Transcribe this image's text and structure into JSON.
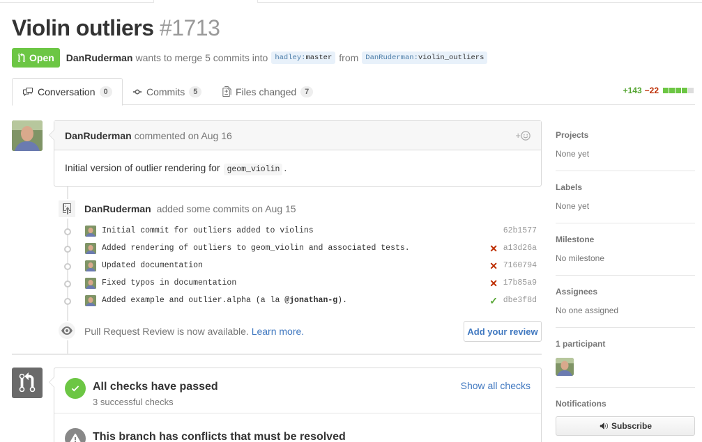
{
  "pr": {
    "title": "Violin outliers",
    "number": "#1713",
    "state": "Open",
    "author": "DanRuderman",
    "merge_text": "wants to merge 5 commits into",
    "base_user": "hadley",
    "base_branch": "master",
    "from_text": "from",
    "head_user": "DanRuderman",
    "head_branch": "violin_outliers"
  },
  "tabs": [
    {
      "label": "Conversation",
      "count": "0",
      "icon": "comment-discussion-icon"
    },
    {
      "label": "Commits",
      "count": "5",
      "icon": "git-commit-icon"
    },
    {
      "label": "Files changed",
      "count": "7",
      "icon": "diff-icon"
    }
  ],
  "diffstat": {
    "additions": "+143",
    "deletions": "−22",
    "add_color": "#55a532",
    "del_color": "#bd2c00",
    "neutral_color": "#ddd"
  },
  "comment": {
    "author": "DanRuderman",
    "action": "commented on Aug 16",
    "body_prefix": "Initial version of outlier rendering for",
    "body_code": "geom_violin",
    "body_suffix": "."
  },
  "commits_event": {
    "author": "DanRuderman",
    "action": "added some commits on Aug 15",
    "commits": [
      {
        "message": "Initial commit for outliers added to violins",
        "status": "",
        "sha": "62b1577"
      },
      {
        "message": "Added rendering of outliers to geom_violin and associated tests.",
        "status": "✕",
        "sha": "a13d26a"
      },
      {
        "message": "Updated documentation",
        "status": "✕",
        "sha": "7160794"
      },
      {
        "message": "Fixed typos in documentation",
        "status": "✕",
        "sha": "17b85a9"
      },
      {
        "message_prefix": "Added example and outlier.alpha (a la ",
        "message_mention": "@jonathan-g",
        "message_suffix": ").",
        "status": "✓",
        "sha": "dbe3f8d"
      }
    ]
  },
  "review": {
    "text": "Pull Request Review is now available.",
    "link": "Learn more.",
    "button": "Add your review"
  },
  "merge": {
    "checks_title": "All checks have passed",
    "checks_sub": "3 successful checks",
    "checks_link": "Show all checks",
    "conflict_title": "This branch has conflicts that must be resolved"
  },
  "sidebar": {
    "projects": {
      "heading": "Projects",
      "value": "None yet"
    },
    "labels": {
      "heading": "Labels",
      "value": "None yet"
    },
    "milestone": {
      "heading": "Milestone",
      "value": "No milestone"
    },
    "assignees": {
      "heading": "Assignees",
      "value": "No one assigned"
    },
    "participants": {
      "heading": "1 participant"
    },
    "notifications": {
      "heading": "Notifications",
      "button": "Subscribe"
    }
  },
  "colors": {
    "open_green": "#6cc644",
    "link_blue": "#4078c0",
    "fail_red": "#bd2c00",
    "ok_green": "#55a532"
  }
}
